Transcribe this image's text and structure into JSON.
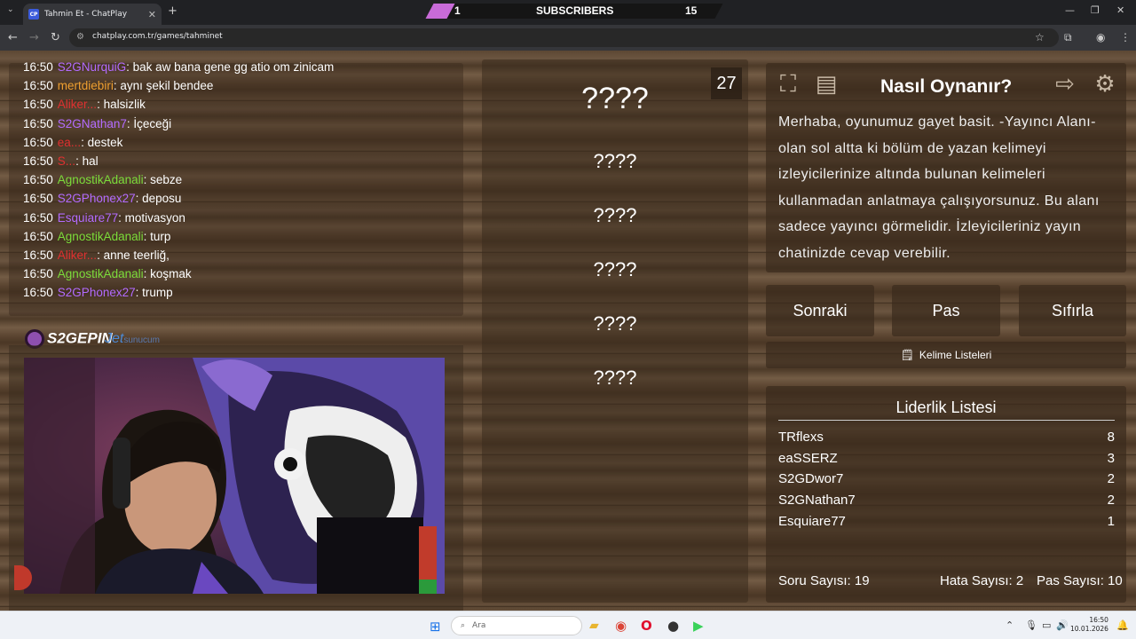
{
  "browser": {
    "tab_title": "Tahmin Et - ChatPlay",
    "tab_favicon": "CP",
    "url": "chatplay.com.tr/games/tahminet"
  },
  "overlay": {
    "left_count": "1",
    "label": "SUBSCRIBERS",
    "right_count": "15"
  },
  "chat": [
    {
      "time": "16:50",
      "user": "S2GNurquiG",
      "color": "#b36bff",
      "msg": ": bak aw bana gene gg atio om zinicam"
    },
    {
      "time": "16:50",
      "user": "mertdiebiri",
      "color": "#f0a030",
      "msg": ": aynı şekil bendee"
    },
    {
      "time": "16:50",
      "user": "Aliker...",
      "color": "#e03030",
      "msg": ": halsizlik"
    },
    {
      "time": "16:50",
      "user": "S2GNathan7",
      "color": "#b36bff",
      "msg": ": İçeceği"
    },
    {
      "time": "16:50",
      "user": "ea...",
      "color": "#e03030",
      "msg": ": destek"
    },
    {
      "time": "16:50",
      "user": "S...",
      "color": "#e03030",
      "msg": ": hal"
    },
    {
      "time": "16:50",
      "user": "AgnostikAdanali",
      "color": "#7cdc3a",
      "msg": ": sebze"
    },
    {
      "time": "16:50",
      "user": "S2GPhonex27",
      "color": "#b36bff",
      "msg": ": deposu"
    },
    {
      "time": "16:50",
      "user": "Esquiare77",
      "color": "#b36bff",
      "msg": ": motivasyon"
    },
    {
      "time": "16:50",
      "user": "AgnostikAdanali",
      "color": "#7cdc3a",
      "msg": ": turp"
    },
    {
      "time": "16:50",
      "user": "Aliker...",
      "color": "#e03030",
      "msg": ": anne teerliğ,"
    },
    {
      "time": "16:50",
      "user": "AgnostikAdanali",
      "color": "#7cdc3a",
      "msg": ": koşmak"
    },
    {
      "time": "16:50",
      "user": "S2GPhonex27",
      "color": "#b36bff",
      "msg": ": trump"
    }
  ],
  "logos": {
    "brand": "S2GEPIN",
    "sponsor": "Jet",
    "sponsor_suffix": "sunucum"
  },
  "game": {
    "timer": "27",
    "main_word": "????",
    "hint_words": [
      "????",
      "????",
      "????",
      "????",
      "????"
    ]
  },
  "how": {
    "title": "Nasıl Oynanır?",
    "text": "Merhaba, oyunumuz gayet basit. -Yayıncı Alanı- olan sol altta ki bölüm de yazan kelimeyi izleyicilerinize altında bulunan kelimeleri kullanmadan anlatmaya çalışıyorsunuz. Bu alanı sadece yayıncı görmelidir. İzleyicileriniz yayın chatinizde cevap verebilir."
  },
  "buttons": {
    "next": "Sonraki",
    "pass": "Pas",
    "reset": "Sıfırla",
    "word_lists": "Kelime Listeleri"
  },
  "leaderboard": {
    "title": "Liderlik Listesi",
    "rows": [
      {
        "name": "TRflexs",
        "score": "8"
      },
      {
        "name": "eaSSERZ",
        "score": "3"
      },
      {
        "name": "S2GDwor7",
        "score": "2"
      },
      {
        "name": "S2GNathan7",
        "score": "2"
      },
      {
        "name": "Esquiare77",
        "score": "1"
      }
    ]
  },
  "stats": {
    "questions": "Soru Sayısı: 19",
    "errors": "Hata Sayısı: 2",
    "passes": "Pas Sayısı: 10"
  },
  "taskbar": {
    "search_placeholder": "Ara",
    "time": "16:50",
    "date": "10.01.2026"
  }
}
